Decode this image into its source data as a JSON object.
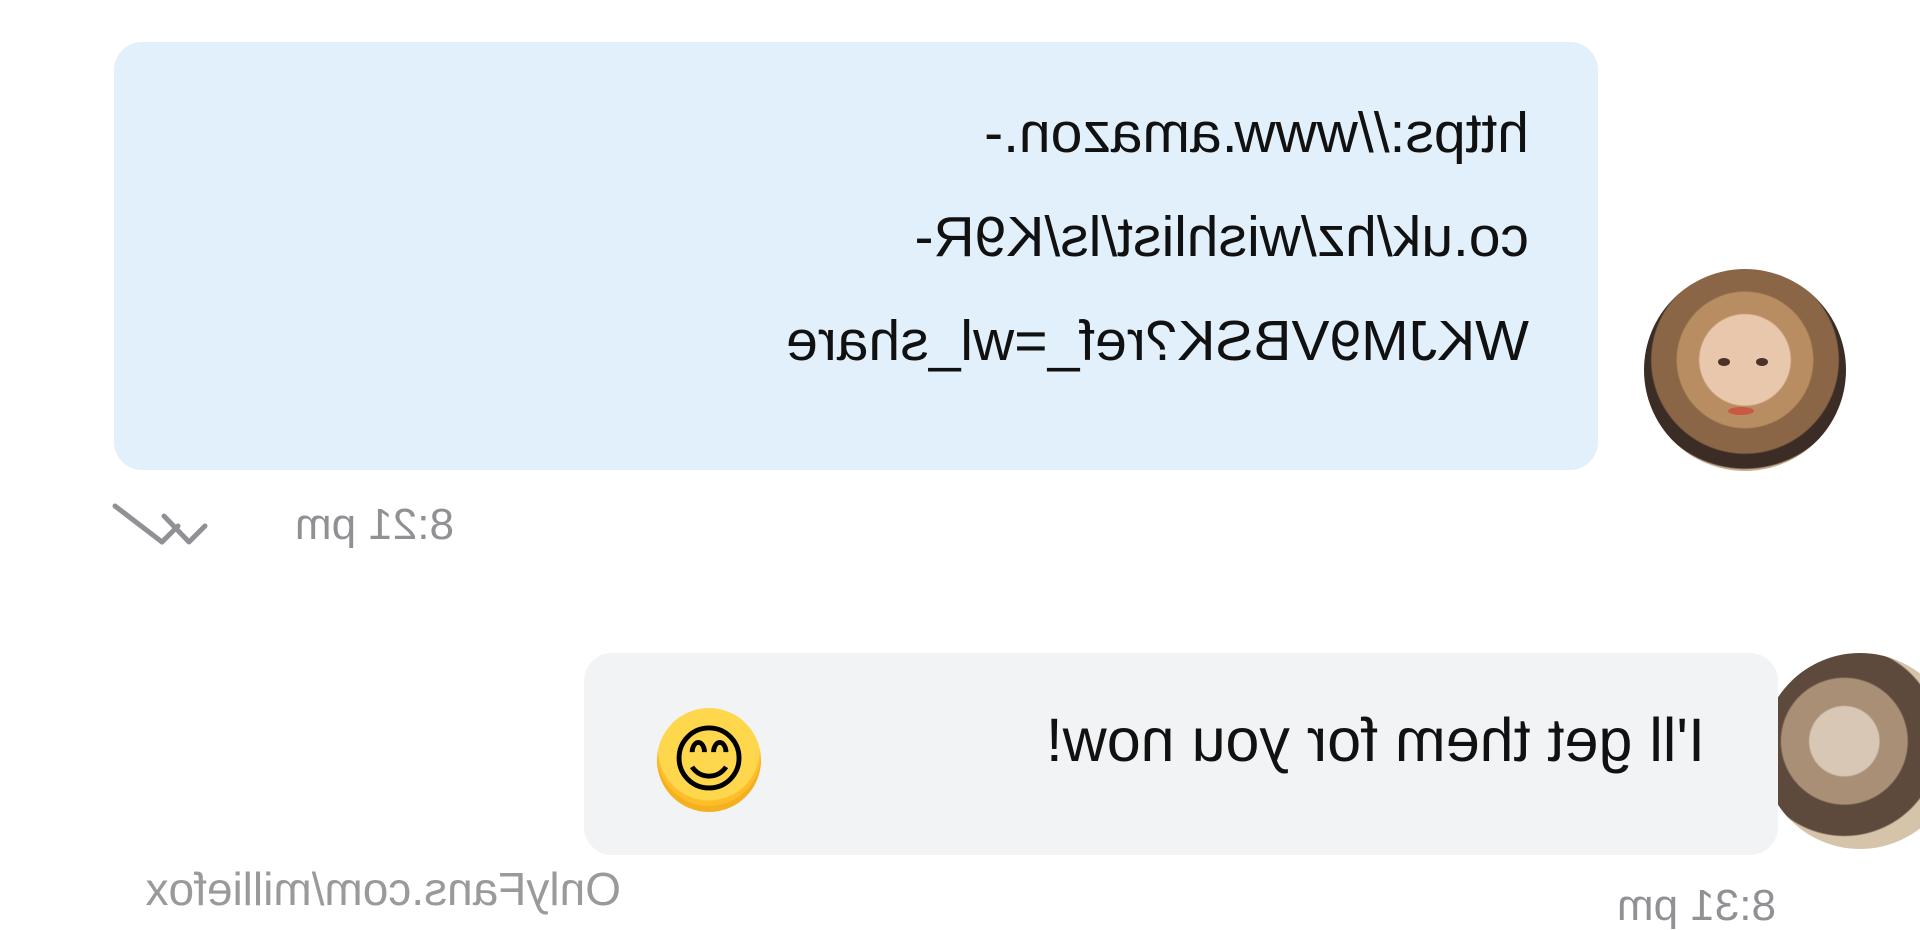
{
  "conversation": {
    "message_link": {
      "lines": [
        "https://www.amazon.-",
        "co.uk/hz/wishlist/ls/K9R-",
        "WKJM9VBSK?ref_=wl_share"
      ],
      "timestamp": "8:21 pm"
    },
    "reply_message": {
      "text": "I'll get them for you now!",
      "emoji": "😊",
      "timestamp": "8:31 pm"
    }
  },
  "watermark": {
    "text": "OnlyFans.com/milliefox"
  },
  "icons": {
    "read_receipt": "double-check-icon",
    "emoji_name": "smiling-face-icon"
  },
  "colors": {
    "link_bubble": "#e1f0fa",
    "reply_bubble": "#f2f3f5",
    "timestamp": "#8f9194"
  }
}
